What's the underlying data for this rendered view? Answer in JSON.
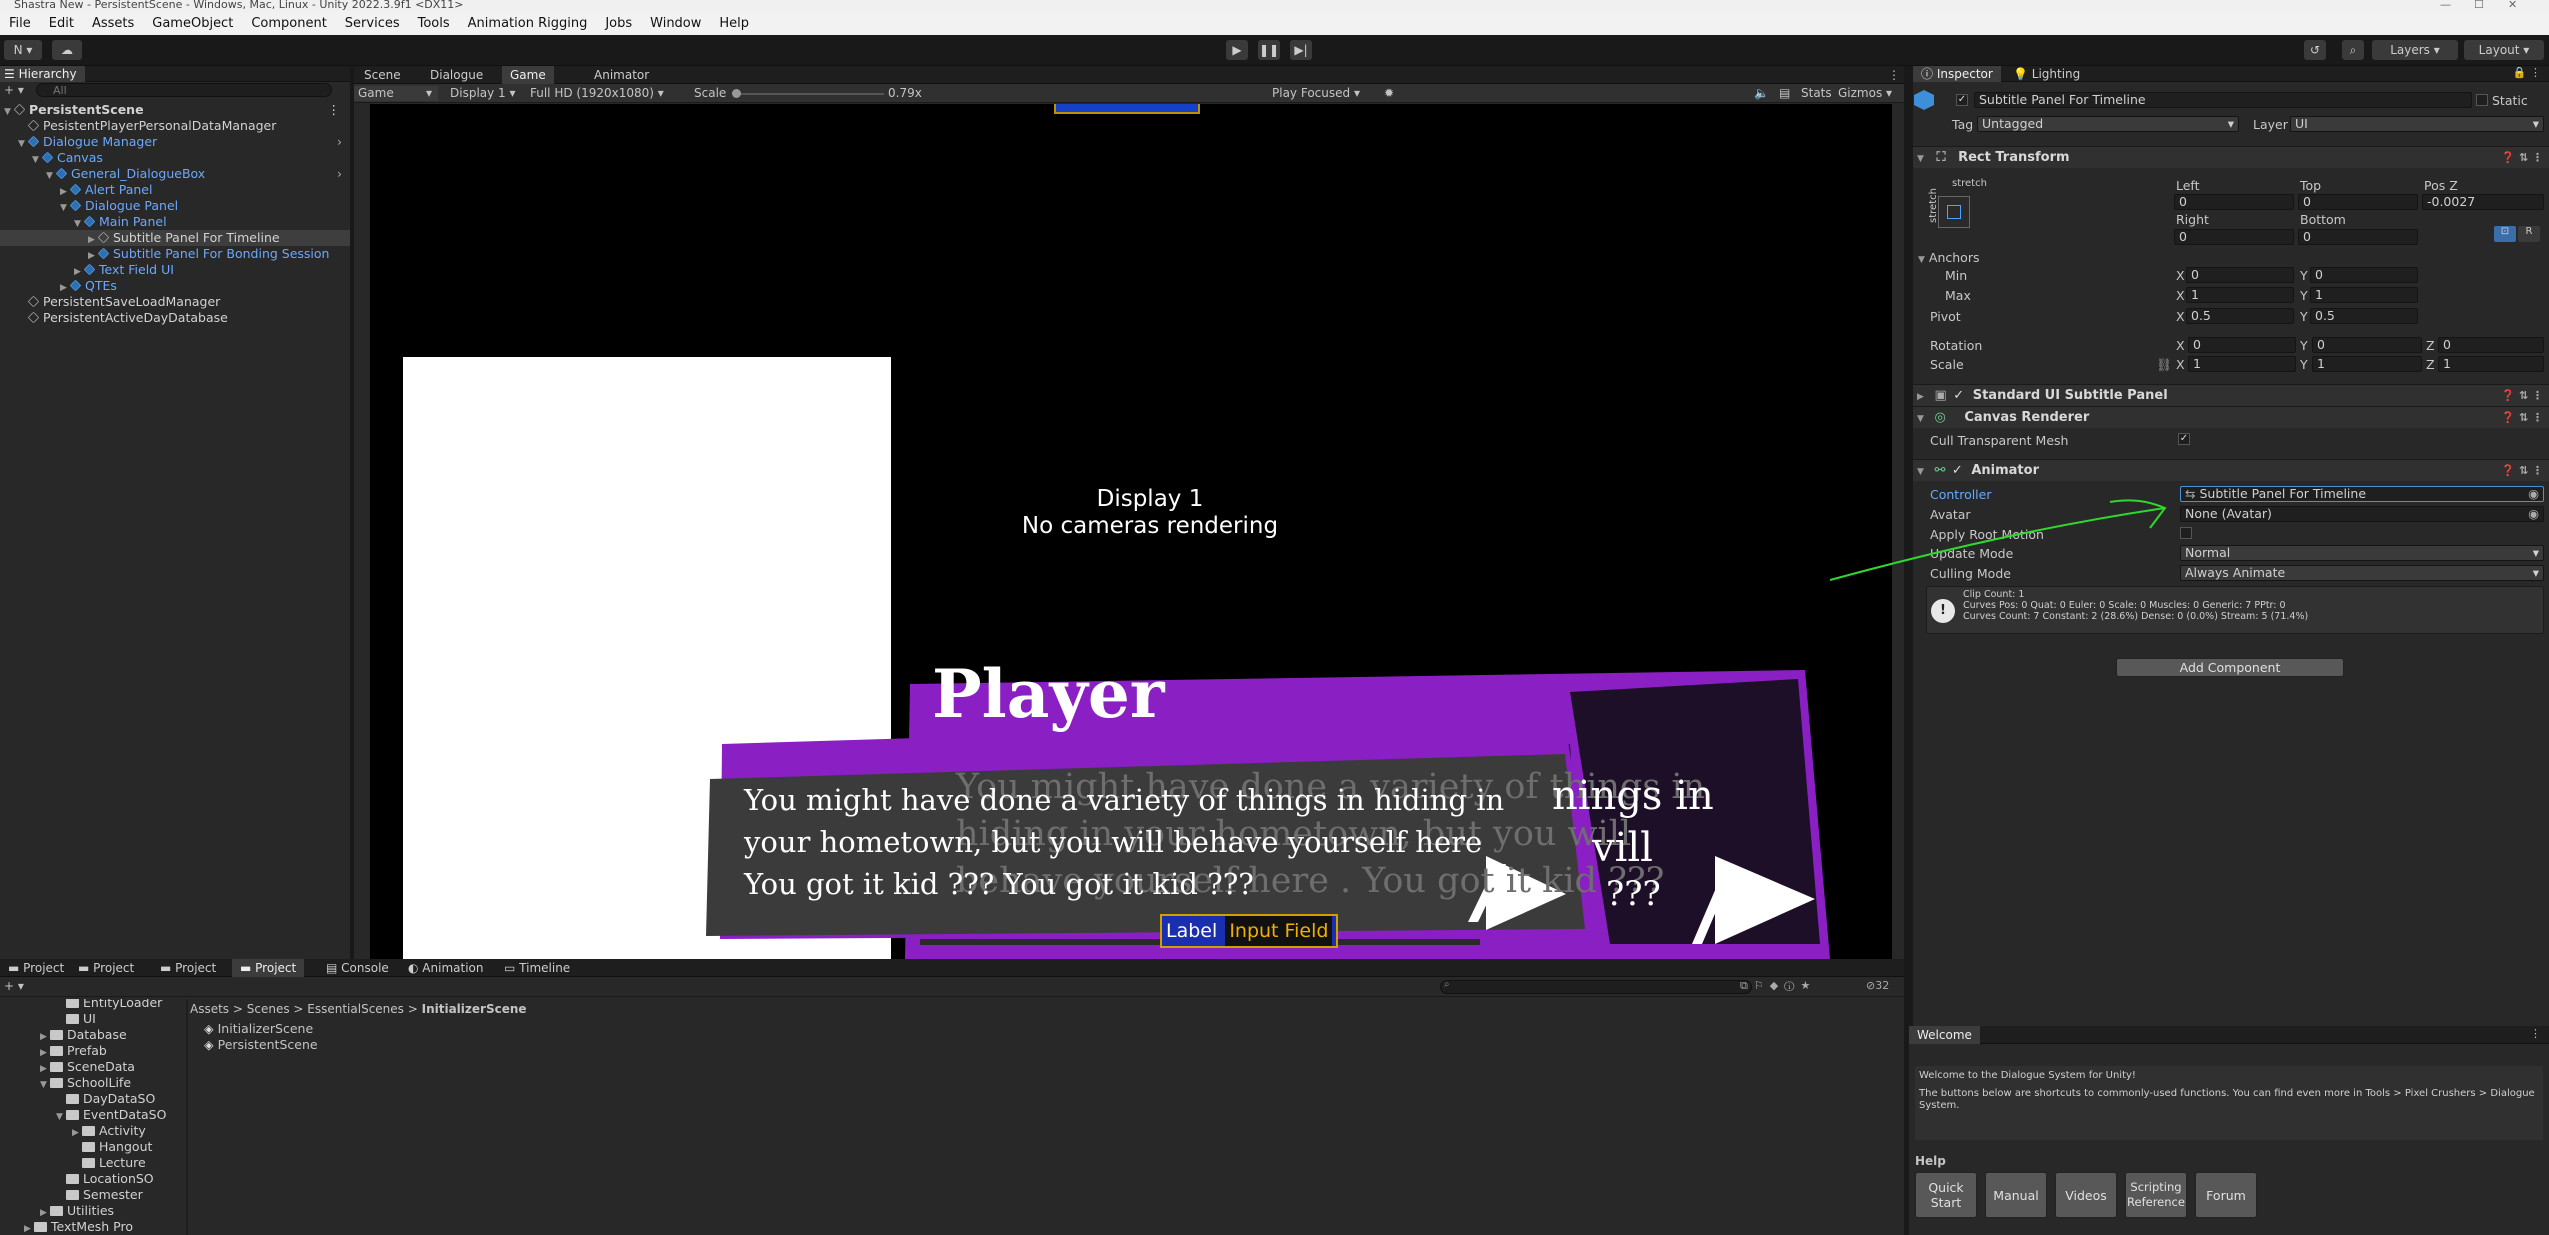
{
  "window": {
    "title": "Shastra New - PersistentScene - Windows, Mac, Linux - Unity 2022.3.9f1 <DX11>"
  },
  "menu": [
    "File",
    "Edit",
    "Assets",
    "GameObject",
    "Component",
    "Services",
    "Tools",
    "Animation Rigging",
    "Jobs",
    "Window",
    "Help"
  ],
  "toolbar": {
    "account": "N",
    "layers": "Layers",
    "layout": "Layout"
  },
  "hierarchy": {
    "tab": "Hierarchy",
    "search_placeholder": "All",
    "items": [
      {
        "label": "PersistentScene",
        "indent": 0,
        "kind": "scene"
      },
      {
        "label": "PesistentPlayerPersonalDataManager",
        "indent": 1
      },
      {
        "label": "Dialogue Manager",
        "indent": 1,
        "blue": true
      },
      {
        "label": "Canvas",
        "indent": 2,
        "blue": true
      },
      {
        "label": "General_DialogueBox",
        "indent": 3,
        "blue": true
      },
      {
        "label": "Alert Panel",
        "indent": 4,
        "blue": true
      },
      {
        "label": "Dialogue Panel",
        "indent": 4,
        "blue": true
      },
      {
        "label": "Main Panel",
        "indent": 5,
        "blue": true
      },
      {
        "label": "Subtitle Panel For Timeline",
        "indent": 6,
        "selected": true
      },
      {
        "label": "Subtitle Panel For Bonding Session",
        "indent": 6,
        "blue": true
      },
      {
        "label": "Text Field UI",
        "indent": 5,
        "blue": true
      },
      {
        "label": "QTEs",
        "indent": 4,
        "blue": true
      },
      {
        "label": "PersistentSaveLoadManager",
        "indent": 1
      },
      {
        "label": "PersistentActiveDayDatabase",
        "indent": 1
      }
    ]
  },
  "scene_tabs": [
    "Scene",
    "Dialogue",
    "Game",
    "Animator"
  ],
  "game_bar": {
    "mode": "Game",
    "display": "Display 1",
    "resolution": "Full HD (1920x1080)",
    "scale_label": "Scale",
    "scale_value": "0.79x",
    "play_focus": "Play Focused",
    "stats": "Stats",
    "gizmos": "Gizmos"
  },
  "game_view": {
    "display_line1": "Display 1",
    "display_line2": "No cameras rendering",
    "speaker": "Player",
    "subtitle_line1": "You might have done a variety of things in hiding in",
    "subtitle_line2": "your hometown, but you will behave yourself here",
    "subtitle_line3": "You got it kid ??? You got it kid ???",
    "ghost_line1": "You might have done a variety of things in",
    "ghost_line2": "hiding in your hometown, but you will",
    "ghost_line3": "behave yourself here . You got it kid ???",
    "bg_text": "nings in",
    "bg_vill": "vill",
    "bg_qqq": "???",
    "input_label": "Label",
    "input_field": "Input Field",
    "accent": "#8a1fc4"
  },
  "inspector": {
    "tabs": [
      "Inspector",
      "Lighting"
    ],
    "object_name": "Subtitle Panel For Timeline",
    "static_label": "Static",
    "tag_label": "Tag",
    "tag_value": "Untagged",
    "layer_label": "Layer",
    "layer_value": "UI",
    "rect_transform": {
      "title": "Rect Transform",
      "stretch": "stretch",
      "left_label": "Left",
      "left": "0",
      "top_label": "Top",
      "top": "0",
      "posz_label": "Pos Z",
      "posz": "-0.0027",
      "right_label": "Right",
      "right": "0",
      "bottom_label": "Bottom",
      "bottom": "0",
      "anchors": "Anchors",
      "min": "Min",
      "min_x": "0",
      "min_y": "0",
      "max": "Max",
      "max_x": "1",
      "max_y": "1",
      "pivot": "Pivot",
      "pivot_x": "0.5",
      "pivot_y": "0.5",
      "rotation": "Rotation",
      "rot_x": "0",
      "rot_y": "0",
      "rot_z": "0",
      "scale": "Scale",
      "scale_x": "1",
      "scale_y": "1",
      "scale_z": "1",
      "x": "X",
      "y": "Y",
      "z": "Z"
    },
    "standard_ui": "Standard UI Subtitle Panel",
    "canvas_renderer": "Canvas Renderer",
    "cull_label": "Cull Transparent Mesh",
    "animator": {
      "title": "Animator",
      "controller_label": "Controller",
      "controller": "Subtitle Panel For Timeline",
      "avatar_label": "Avatar",
      "avatar": "None (Avatar)",
      "root_motion_label": "Apply Root Motion",
      "update_label": "Update Mode",
      "update": "Normal",
      "culling_label": "Culling Mode",
      "culling": "Always Animate",
      "info1": "Clip Count: 1",
      "info2": "Curves Pos: 0 Quat: 0 Euler: 0 Scale: 0 Muscles: 0 Generic: 7 PPtr: 0",
      "info3": "Curves Count: 7 Constant: 2 (28.6%) Dense: 0 (0.0%) Stream: 5 (71.4%)"
    },
    "add_component": "Add Component"
  },
  "bottom_tabs": [
    "Project",
    "Project",
    "Project",
    "Project",
    "Console",
    "Animation",
    "Timeline"
  ],
  "project": {
    "count": "32",
    "breadcrumb": [
      "Assets",
      "Scenes",
      "EssentialScenes",
      "InitializerScene"
    ],
    "files": [
      "InitializerScene",
      "PersistentScene"
    ],
    "tree": [
      {
        "label": "EntityLoader",
        "indent": 2
      },
      {
        "label": "UI",
        "indent": 2
      },
      {
        "label": "Database",
        "indent": 1
      },
      {
        "label": "Prefab",
        "indent": 1
      },
      {
        "label": "SceneData",
        "indent": 1
      },
      {
        "label": "SchoolLife",
        "indent": 1
      },
      {
        "label": "DayDataSO",
        "indent": 2
      },
      {
        "label": "EventDataSO",
        "indent": 2
      },
      {
        "label": "Activity",
        "indent": 3
      },
      {
        "label": "Hangout",
        "indent": 3
      },
      {
        "label": "Lecture",
        "indent": 3
      },
      {
        "label": "LocationSO",
        "indent": 2
      },
      {
        "label": "Semester",
        "indent": 2
      },
      {
        "label": "Utilities",
        "indent": 1
      },
      {
        "label": "TextMesh Pro",
        "indent": 0
      }
    ]
  },
  "welcome": {
    "tab": "Welcome",
    "line1": "Welcome to the Dialogue System for Unity!",
    "line2": "The buttons below are shortcuts to commonly-used functions. You can find even more in Tools > Pixel Crushers > Dialogue System.",
    "help": "Help",
    "buttons": [
      "Quick Start",
      "Manual",
      "Videos",
      "Scripting Reference",
      "Forum"
    ]
  }
}
